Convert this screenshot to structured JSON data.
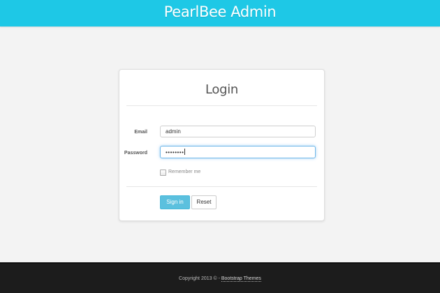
{
  "header": {
    "brand": "PearlBee Admin",
    "background_color": "#1ec8e6"
  },
  "login_form": {
    "title": "Login",
    "email_label": "Email",
    "email_value": "admin",
    "password_label": "Password",
    "password_masked": "••••••••",
    "remember_label": "Remember me",
    "remember_checked": false,
    "signin_label": "Sign in",
    "reset_label": "Reset"
  },
  "footer": {
    "copyright": "Copyright 2013 © - ",
    "link_text": "Bootstrap Themes"
  }
}
